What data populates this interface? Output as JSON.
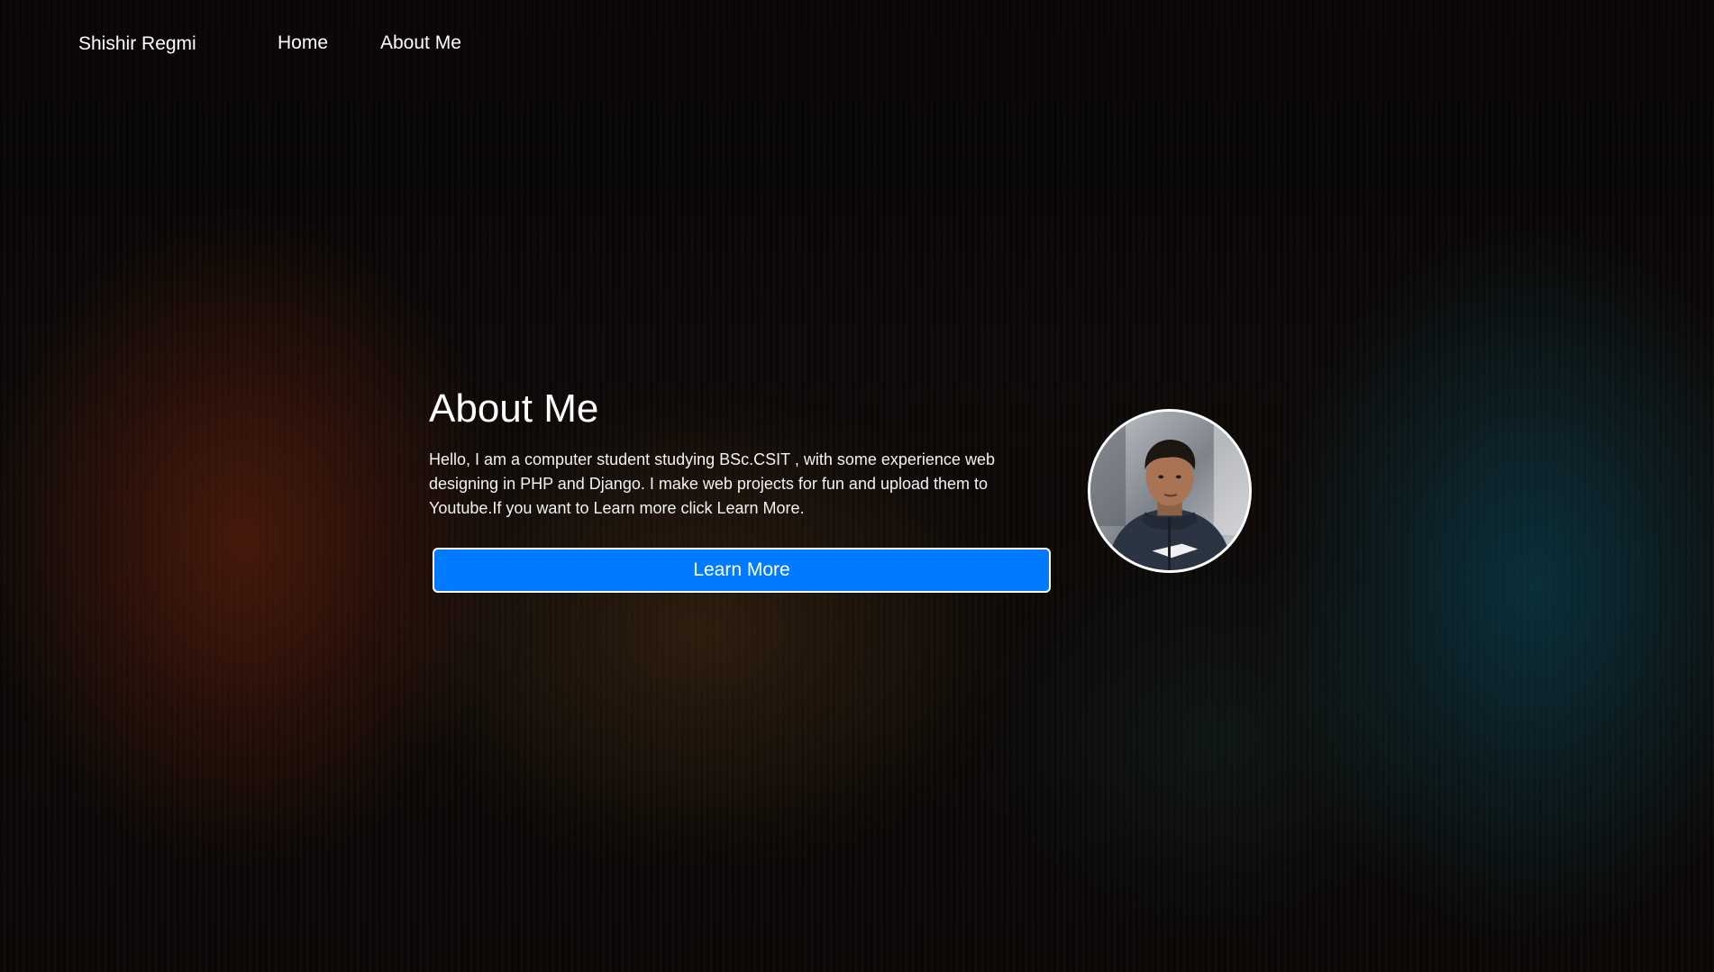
{
  "navbar": {
    "brand": "Shishir Regmi",
    "links": [
      {
        "label": "Home"
      },
      {
        "label": "About Me"
      }
    ]
  },
  "about": {
    "title": "About Me",
    "description": "Hello, I am a computer student studying BSc.CSIT , with some experience web designing in PHP and Django. I make web projects for fun and upload them to Youtube.If you want to Learn more click Learn More.",
    "button_label": "Learn More"
  },
  "profile": {
    "image": "profile-photo"
  },
  "colors": {
    "button": "#007bff",
    "text": "#ffffff"
  }
}
